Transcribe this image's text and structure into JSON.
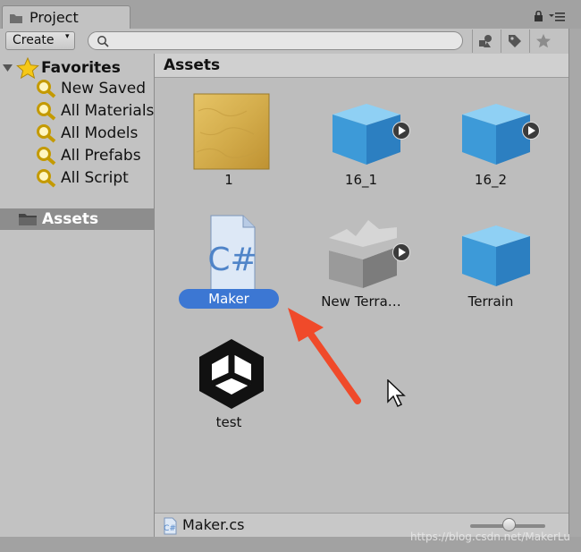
{
  "tab": {
    "title": "Project"
  },
  "toolbar": {
    "create_label": "Create",
    "create_arrow": "▾",
    "search_placeholder": ""
  },
  "sidebar": {
    "favorites_label": "Favorites",
    "favorites": [
      "New Saved",
      "All Materials",
      "All Models",
      "All Prefabs",
      "All Script"
    ],
    "assets_label": "Assets"
  },
  "main": {
    "header": "Assets",
    "items": [
      {
        "name": "1",
        "kind": "material"
      },
      {
        "name": "16_1",
        "kind": "model"
      },
      {
        "name": "16_2",
        "kind": "model"
      },
      {
        "name": "Maker",
        "kind": "csharp-script",
        "selected": true
      },
      {
        "name": "New Terra…",
        "kind": "terrain"
      },
      {
        "name": "Terrain",
        "kind": "model"
      },
      {
        "name": "test",
        "kind": "unity-scene"
      }
    ]
  },
  "status": {
    "selected_file": "Maker.cs"
  },
  "watermark": "https://blog.csdn.net/MakerLu",
  "colors": {
    "selection": "#3c77d3",
    "arrow": "#f04a2a",
    "cube": "#4ba6e0"
  }
}
